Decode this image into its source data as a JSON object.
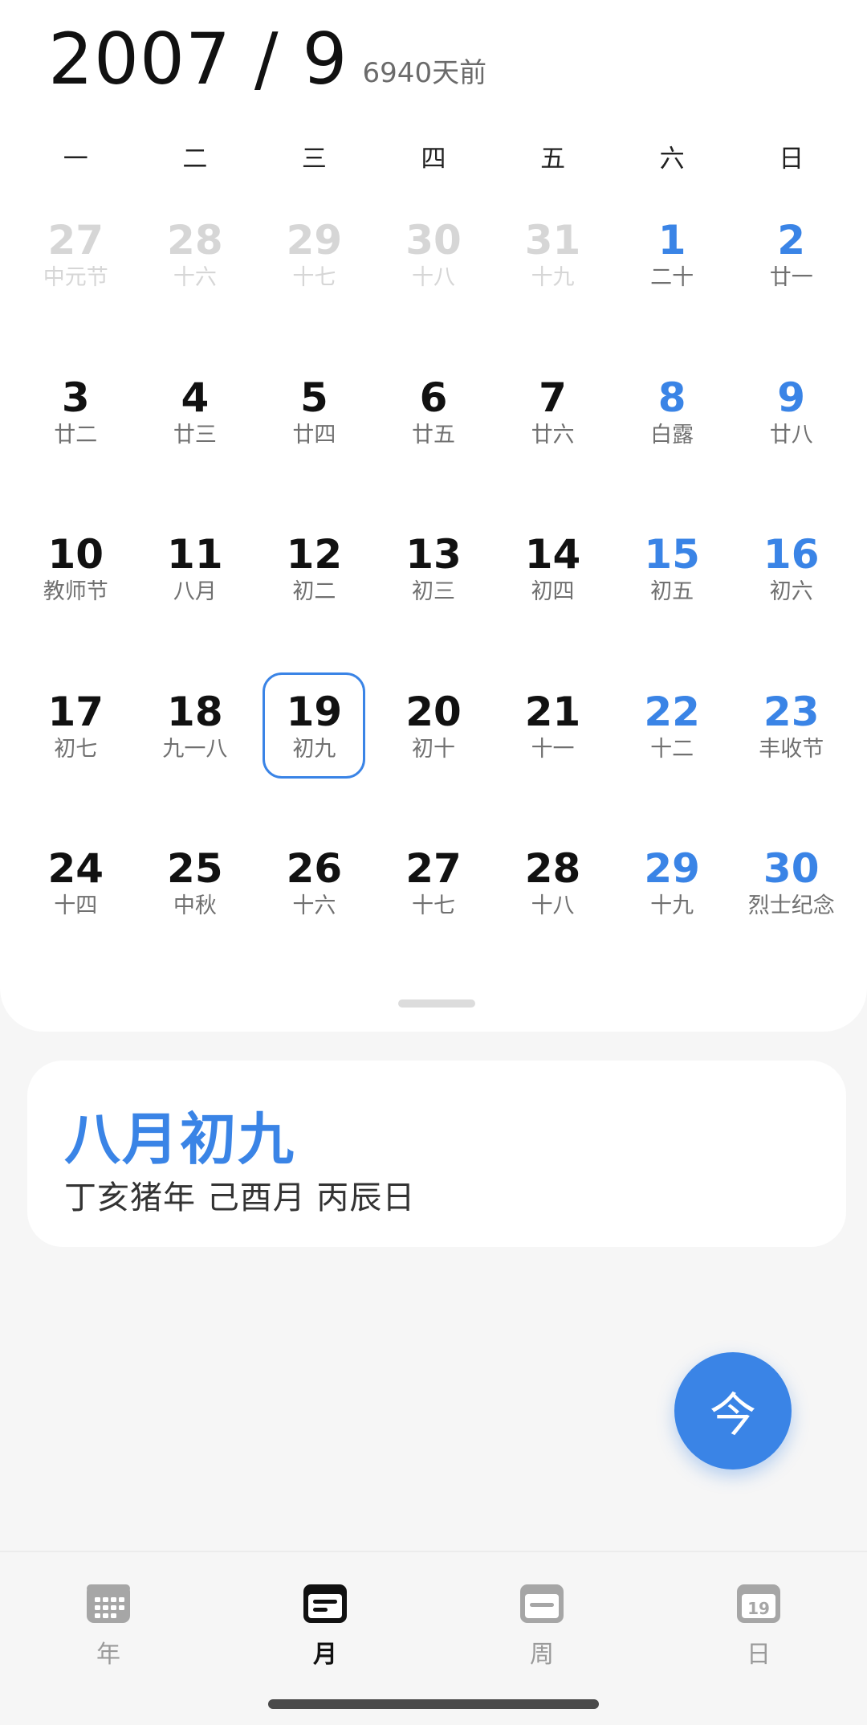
{
  "header": {
    "title": "2007 / 9",
    "days_ago": "6940天前"
  },
  "weekdays": [
    "一",
    "二",
    "三",
    "四",
    "五",
    "六",
    "日"
  ],
  "calendar": {
    "weeks": [
      [
        {
          "day": "27",
          "sub": "中元节",
          "kind": "other"
        },
        {
          "day": "28",
          "sub": "十六",
          "kind": "other"
        },
        {
          "day": "29",
          "sub": "十七",
          "kind": "other"
        },
        {
          "day": "30",
          "sub": "十八",
          "kind": "other"
        },
        {
          "day": "31",
          "sub": "十九",
          "kind": "other"
        },
        {
          "day": "1",
          "sub": "二十",
          "kind": "weekend"
        },
        {
          "day": "2",
          "sub": "廿一",
          "kind": "weekend"
        }
      ],
      [
        {
          "day": "3",
          "sub": "廿二",
          "kind": "normal"
        },
        {
          "day": "4",
          "sub": "廿三",
          "kind": "normal"
        },
        {
          "day": "5",
          "sub": "廿四",
          "kind": "normal"
        },
        {
          "day": "6",
          "sub": "廿五",
          "kind": "normal"
        },
        {
          "day": "7",
          "sub": "廿六",
          "kind": "normal"
        },
        {
          "day": "8",
          "sub": "白露",
          "kind": "weekend"
        },
        {
          "day": "9",
          "sub": "廿八",
          "kind": "weekend"
        }
      ],
      [
        {
          "day": "10",
          "sub": "教师节",
          "kind": "normal"
        },
        {
          "day": "11",
          "sub": "八月",
          "kind": "normal"
        },
        {
          "day": "12",
          "sub": "初二",
          "kind": "normal"
        },
        {
          "day": "13",
          "sub": "初三",
          "kind": "normal"
        },
        {
          "day": "14",
          "sub": "初四",
          "kind": "normal"
        },
        {
          "day": "15",
          "sub": "初五",
          "kind": "weekend"
        },
        {
          "day": "16",
          "sub": "初六",
          "kind": "weekend"
        }
      ],
      [
        {
          "day": "17",
          "sub": "初七",
          "kind": "normal"
        },
        {
          "day": "18",
          "sub": "九一八",
          "kind": "normal"
        },
        {
          "day": "19",
          "sub": "初九",
          "kind": "selected"
        },
        {
          "day": "20",
          "sub": "初十",
          "kind": "normal"
        },
        {
          "day": "21",
          "sub": "十一",
          "kind": "normal"
        },
        {
          "day": "22",
          "sub": "十二",
          "kind": "weekend"
        },
        {
          "day": "23",
          "sub": "丰收节",
          "kind": "weekend"
        }
      ],
      [
        {
          "day": "24",
          "sub": "十四",
          "kind": "normal"
        },
        {
          "day": "25",
          "sub": "中秋",
          "kind": "normal"
        },
        {
          "day": "26",
          "sub": "十六",
          "kind": "normal"
        },
        {
          "day": "27",
          "sub": "十七",
          "kind": "normal"
        },
        {
          "day": "28",
          "sub": "十八",
          "kind": "normal"
        },
        {
          "day": "29",
          "sub": "十九",
          "kind": "weekend"
        },
        {
          "day": "30",
          "sub": "烈士纪念",
          "kind": "weekend"
        }
      ]
    ]
  },
  "lunar": {
    "date": "八月初九",
    "ganzhi": "丁亥猪年 己酉月 丙辰日"
  },
  "fab": {
    "label": "今"
  },
  "nav": {
    "items": [
      {
        "label": "年",
        "icon": "year-grid-icon",
        "active": false
      },
      {
        "label": "月",
        "icon": "month-icon",
        "active": true
      },
      {
        "label": "周",
        "icon": "week-icon",
        "active": false
      },
      {
        "label": "日",
        "icon": "day-icon",
        "active": false,
        "icon_text": "19"
      }
    ]
  },
  "colors": {
    "accent": "#3a84e6",
    "muted": "#d6d6d6",
    "text": "#111111"
  }
}
